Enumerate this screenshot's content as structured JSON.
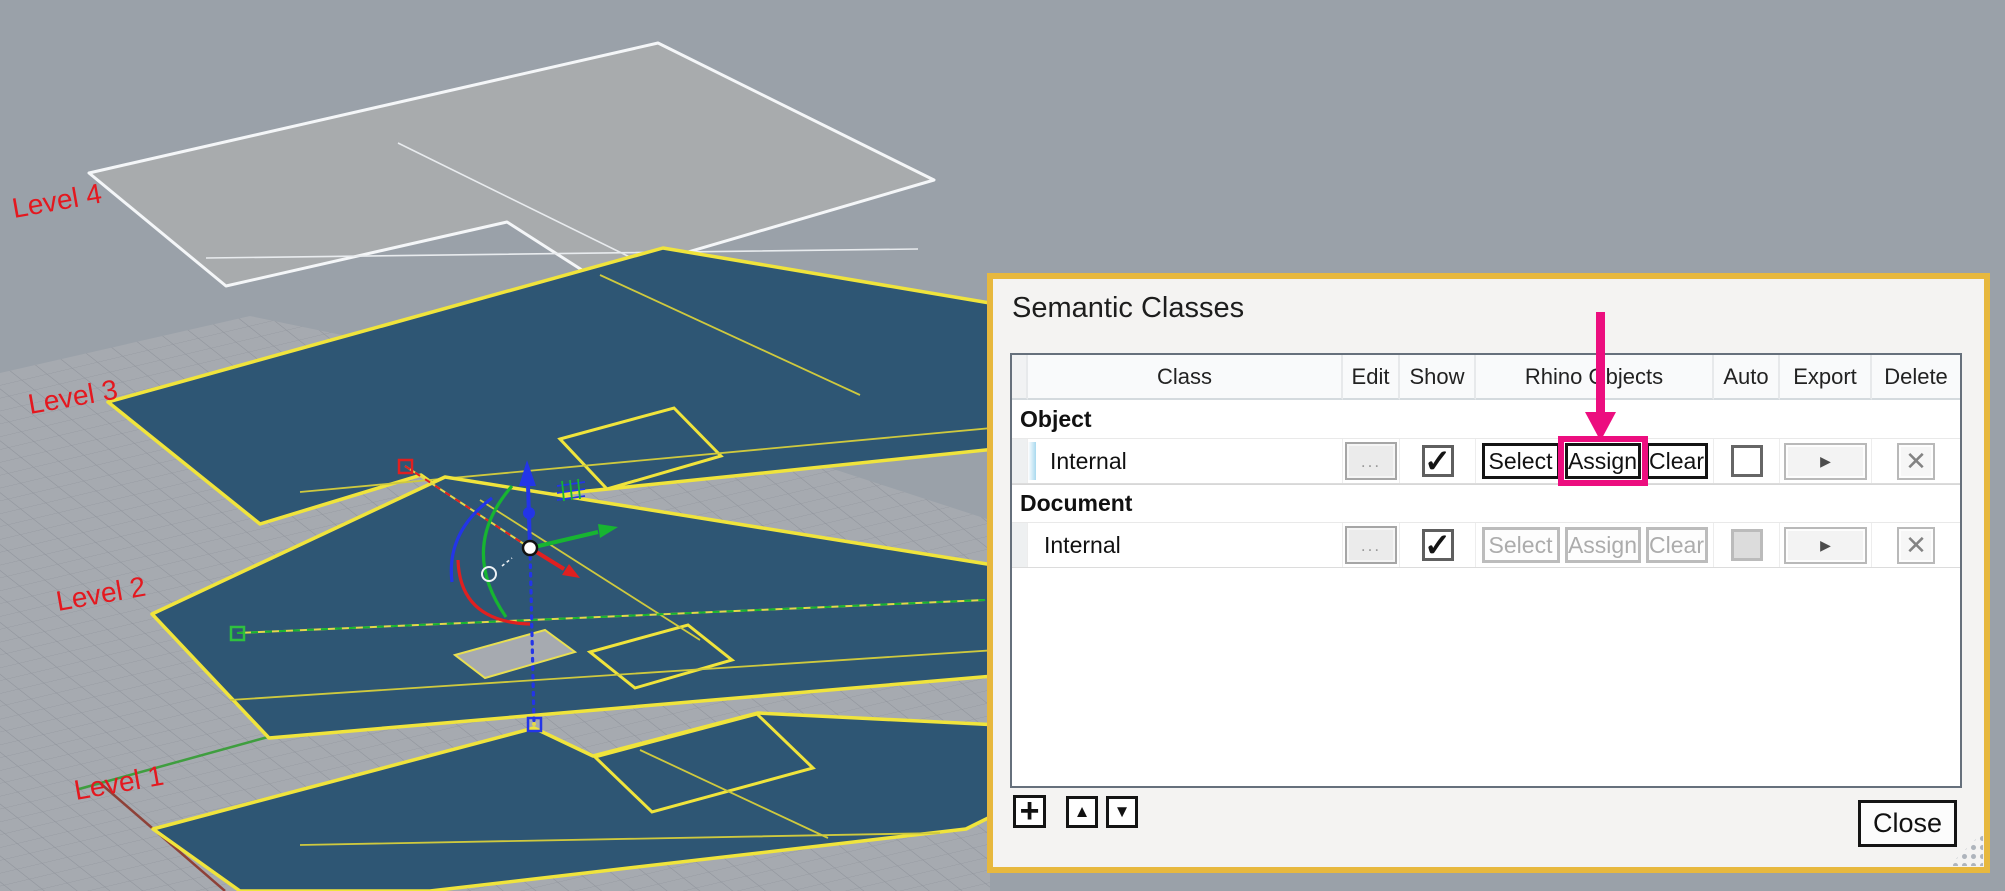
{
  "dialog": {
    "title": "Semantic Classes",
    "table": {
      "columns": [
        "Class",
        "Edit",
        "Show",
        "Rhino Objects",
        "Auto",
        "Export",
        "Delete"
      ],
      "rows": [
        {
          "group": "Object",
          "name": "Internal",
          "edit": "...",
          "select": "Select",
          "assign": "Assign",
          "clear": "Clear",
          "show_checked": true,
          "auto_checked": false,
          "state": "enabled",
          "highlighted_button": "Assign"
        },
        {
          "group": "Document",
          "name": "Internal",
          "edit": "...",
          "select": "Select",
          "assign": "Assign",
          "clear": "Clear",
          "show_checked": true,
          "auto_checked": false,
          "state": "disabled"
        }
      ]
    },
    "footer": {
      "close": "Close"
    }
  },
  "icons": {
    "check": "✓",
    "arrow_right": "▶",
    "x": "✕",
    "plus": "+",
    "up": "▲",
    "down": "▼"
  },
  "viewport": {
    "levels": [
      "Level 4",
      "Level 3",
      "Level 2",
      "Level 1"
    ]
  },
  "colors": {
    "viewport_bg": "#9aa1a9",
    "slab_fill": "#2e5674",
    "slab_outline": "#f0e43c",
    "wireframe_slab": "#a8abad",
    "label_red": "#e4181f",
    "dialog_border": "#e7b83e",
    "accent_pink": "#ec0e7f",
    "gumball_x": "#e02020",
    "gumball_y": "#17b531",
    "gumball_z": "#2335e8"
  }
}
